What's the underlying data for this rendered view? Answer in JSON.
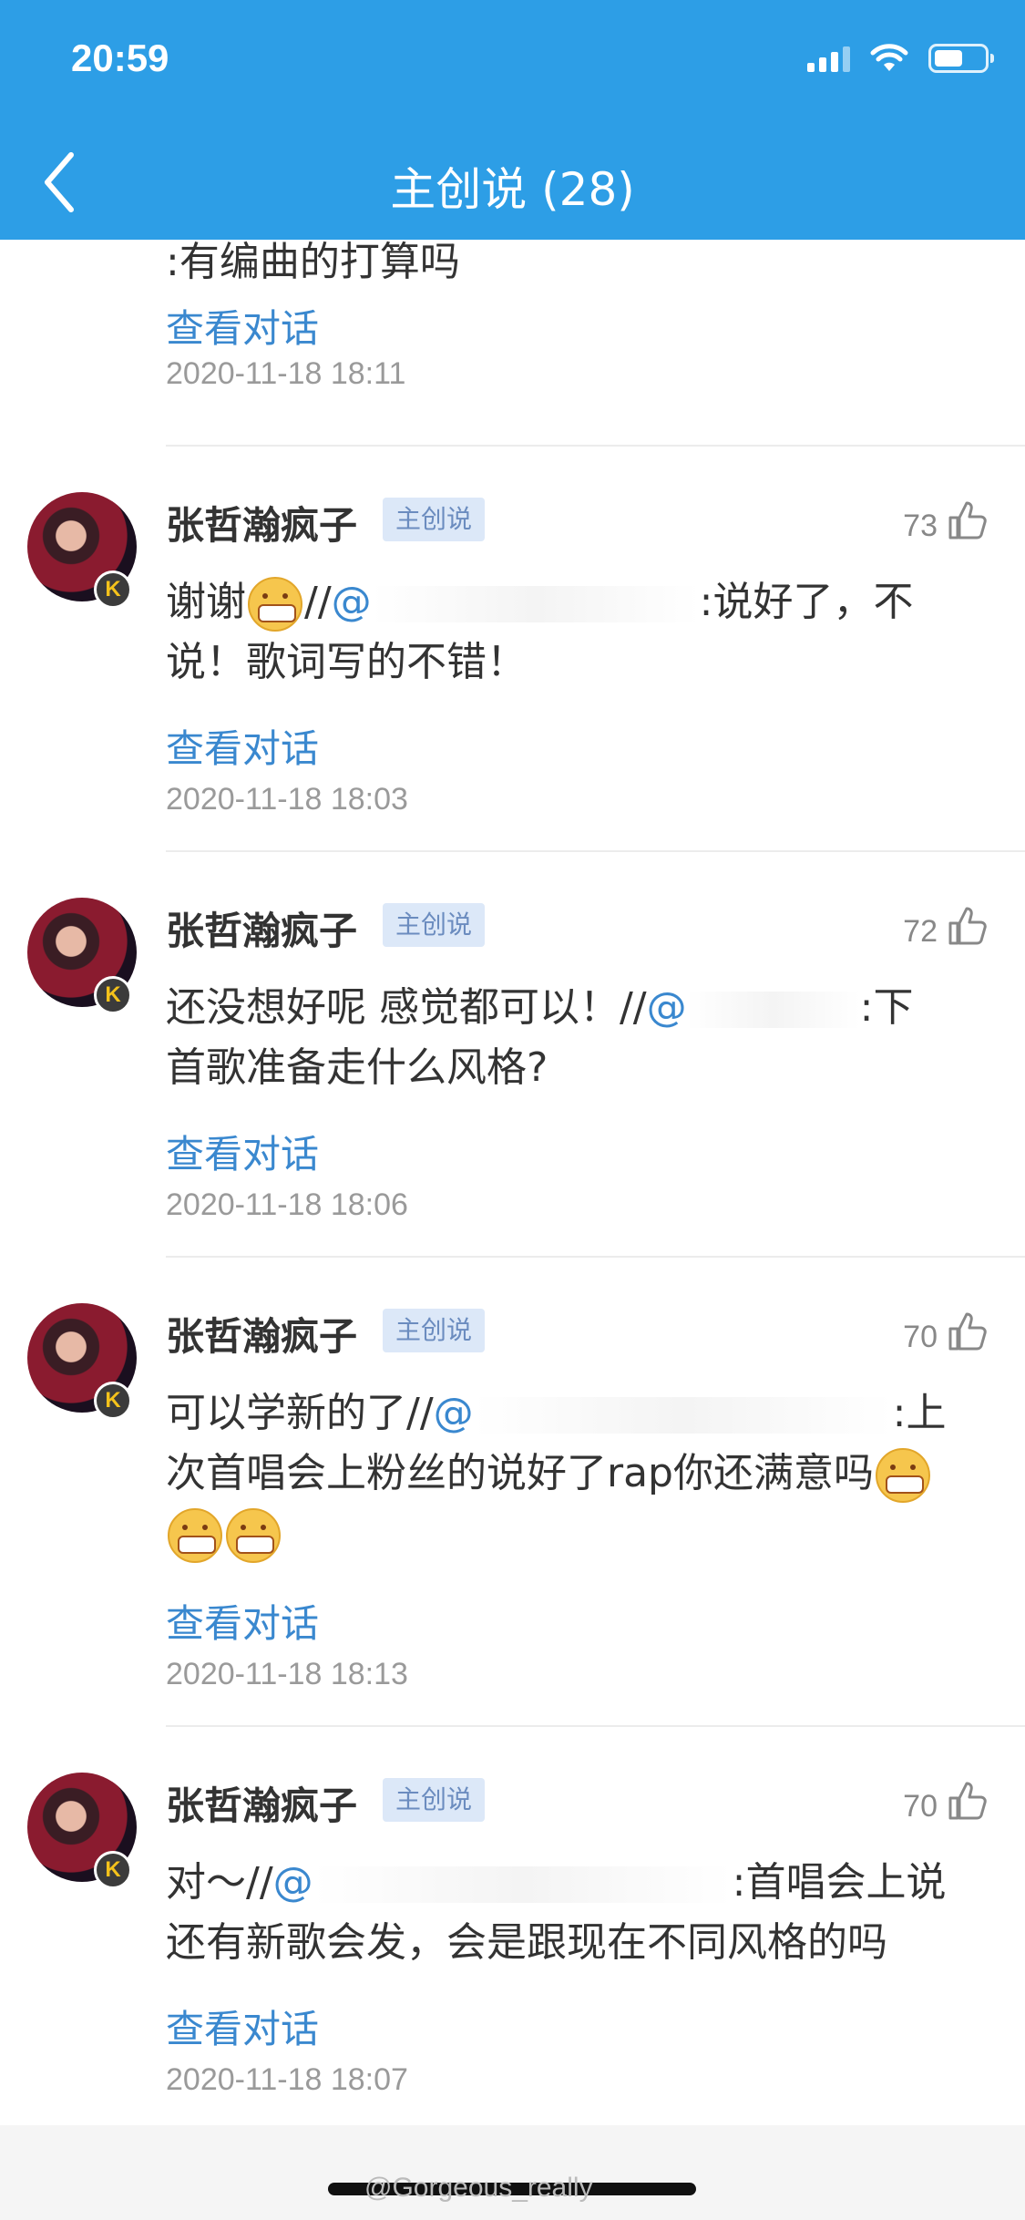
{
  "status_bar": {
    "time": "20:59"
  },
  "header": {
    "title": "主创说 (28)"
  },
  "top_fragment": {
    "text": ":有编曲的打算吗",
    "link": "查看对话",
    "timestamp": "2020-11-18 18:11"
  },
  "comments": [
    {
      "name": "张哲瀚疯子",
      "tag": "主创说",
      "likes": "73",
      "line1_pre": "谢谢",
      "line1_mid": "//",
      "mention": "@",
      "line1_post": ":说好了，不",
      "line2": "说！歌词写的不错！",
      "link": "查看对话",
      "timestamp": "2020-11-18 18:03"
    },
    {
      "name": "张哲瀚疯子",
      "tag": "主创说",
      "likes": "72",
      "line1_pre": "还没想好呢  感觉都可以！//",
      "mention": "@",
      "line1_post": ":下",
      "line2": "首歌准备走什么风格?",
      "link": "查看对话",
      "timestamp": "2020-11-18 18:06"
    },
    {
      "name": "张哲瀚疯子",
      "tag": "主创说",
      "likes": "70",
      "line1_pre": "可以学新的了//",
      "mention": "@",
      "line1_post": ":上",
      "line2": "次首唱会上粉丝的说好了rap你还满意吗",
      "link": "查看对话",
      "timestamp": "2020-11-18 18:13"
    },
    {
      "name": "张哲瀚疯子",
      "tag": "主创说",
      "likes": "70",
      "line1_pre": "对～//",
      "mention": "@",
      "line1_post": ":首唱会上说",
      "line2": "还有新歌会发，会是跟现在不同风格的吗",
      "link": "查看对话",
      "timestamp": "2020-11-18 18:07"
    }
  ],
  "watermark": "@Gorgeous_really",
  "colors": {
    "header_bg": "#2d9ee6",
    "link": "#3a88cf",
    "tag_bg": "#dce8f8"
  }
}
